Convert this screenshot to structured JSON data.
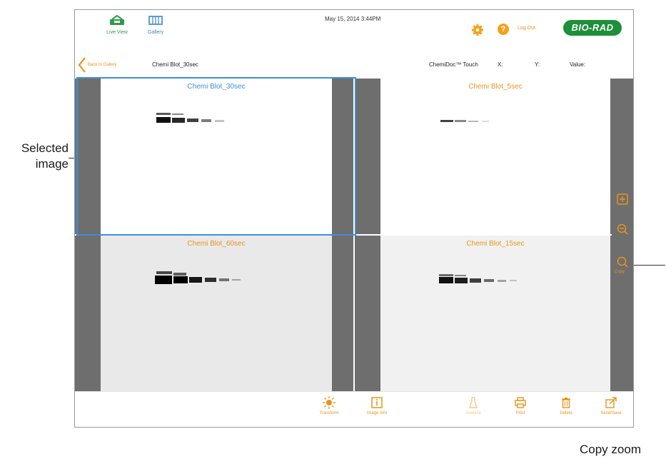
{
  "callouts": {
    "selected_line1": "Selected",
    "selected_line2": "image",
    "copy_zoom": "Copy zoom"
  },
  "topbar": {
    "live_view_label": "Live View",
    "gallery_label": "Gallery",
    "date": "May 15, 2014 3:44PM",
    "logout_label": "Log Out",
    "brand_logo": "BIO-RAD"
  },
  "subbar": {
    "back_label": "Back to Gallery",
    "image_title": "Chemi Blot_30sec",
    "instrument": "ChemiDoc™ Touch",
    "x_label": "X:",
    "y_label": "Y:",
    "value_label": "Value:"
  },
  "panels": [
    {
      "title": "Chemi Blot_30sec",
      "selected": true
    },
    {
      "title": "Chemi Blot_5sec",
      "selected": false
    },
    {
      "title": "Chemi Blot_60sec",
      "selected": false
    },
    {
      "title": "Chemi Blot_15sec",
      "selected": false
    }
  ],
  "zoom": {
    "zoom_in_icon": "zoom-in-icon",
    "zoom_out_icon": "zoom-out-icon",
    "copy_zoom_icon": "copy-zoom-icon",
    "copy_label": "Copy"
  },
  "toolbar": {
    "transform_label": "Transform",
    "image_info_label": "Image Info",
    "analyze_label": "Analyze",
    "print_label": "Print",
    "delete_label": "Delete",
    "send_save_label": "Send/Save"
  },
  "colors": {
    "accent_orange": "#e8941a",
    "selection_blue": "#3d8fd9",
    "brand_green": "#1e8f3a",
    "divider_gray": "#6e6e6e"
  }
}
